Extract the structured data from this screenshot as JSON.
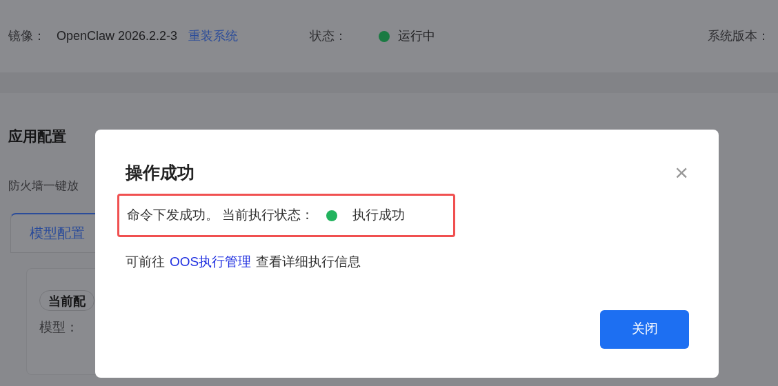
{
  "info_bar": {
    "image_label": "镜像：",
    "image_value": "OpenClaw 2026.2.2-3",
    "reinstall_link": "重装系统",
    "status_label": "状态：",
    "status": {
      "text": "运行中",
      "color": "#1a7a42"
    },
    "version_label": "系统版本："
  },
  "section": {
    "title": "应用配置",
    "firewall_text": "防火墙一键放",
    "tabs": [
      {
        "label": "模型配置",
        "selected": true
      }
    ],
    "config_tag": "当前配",
    "model_label": "模型："
  },
  "dialog": {
    "title": "操作成功",
    "close_icon": "×",
    "message": {
      "prefix": "命令下发成功。 当前执行状态：",
      "status": {
        "text": "执行成功",
        "color": "#22b35e"
      }
    },
    "hint": {
      "before": "可前往",
      "link": "OOS执行管理",
      "after": "查看详细执行信息"
    },
    "button": "关闭"
  }
}
